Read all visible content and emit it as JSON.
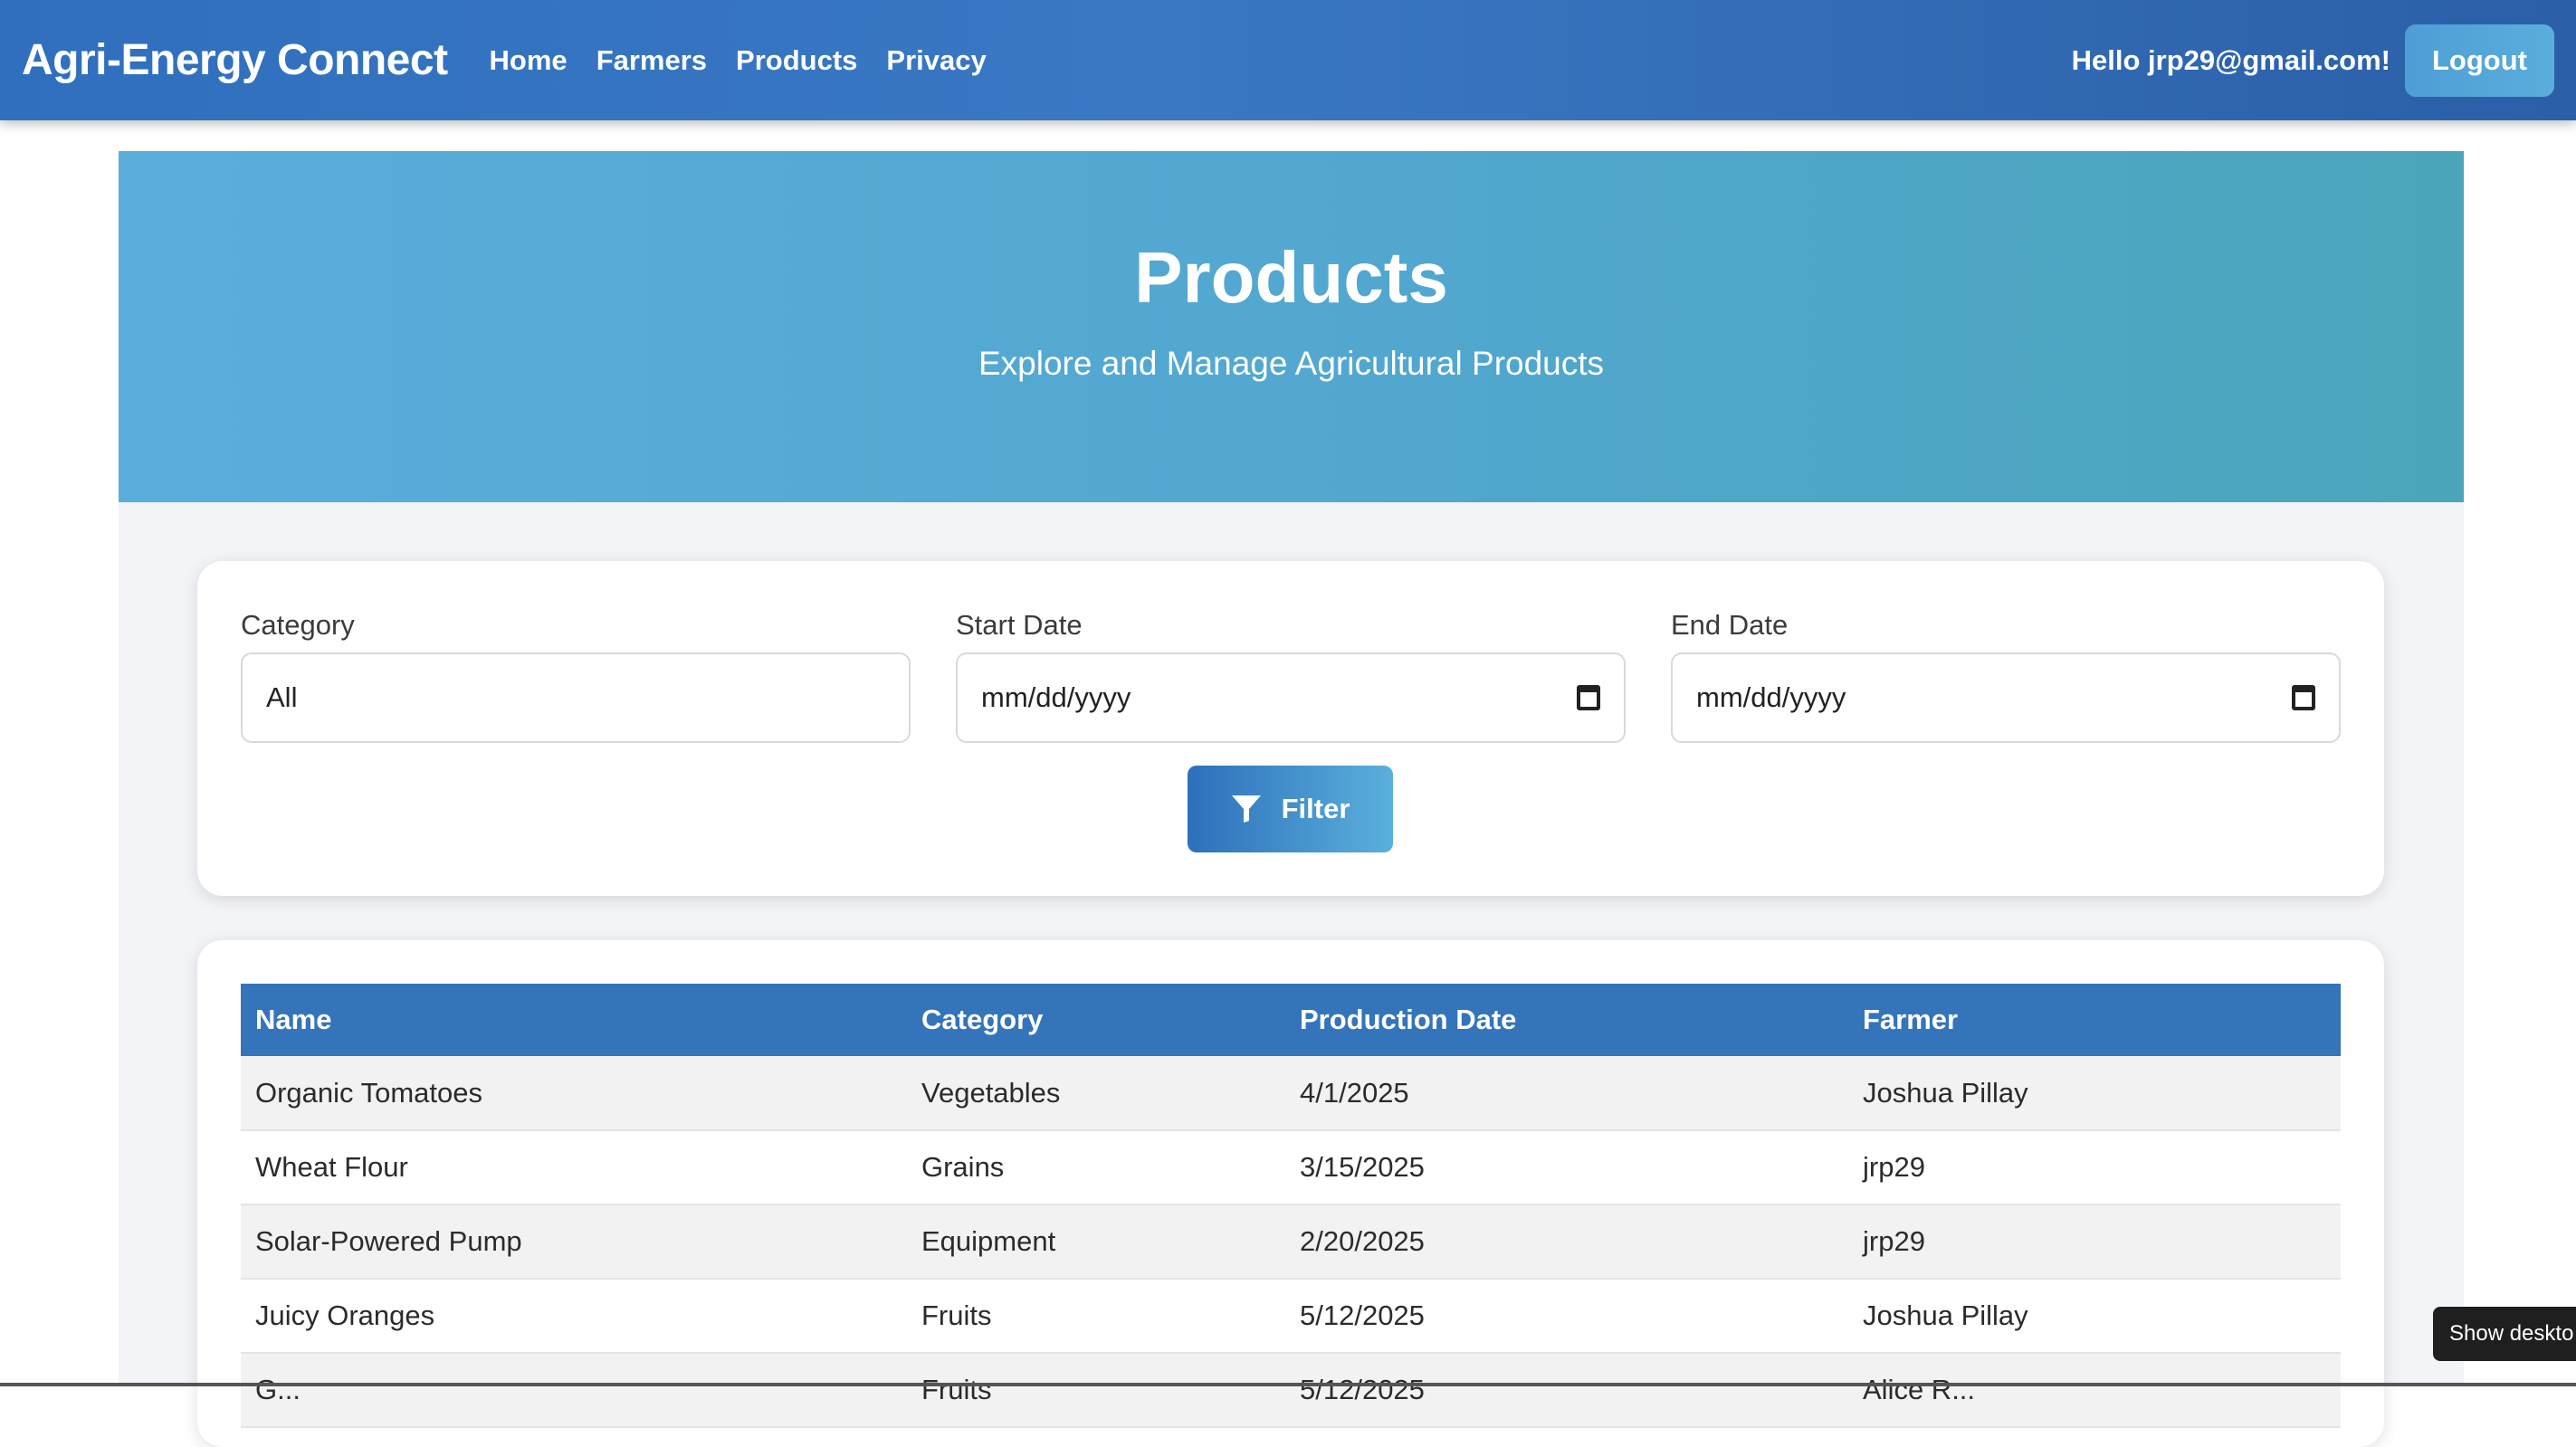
{
  "navbar": {
    "brand": "Agri-Energy Connect",
    "links": [
      "Home",
      "Farmers",
      "Products",
      "Privacy"
    ],
    "greeting": "Hello jrp29@gmail.com!",
    "logout_label": "Logout"
  },
  "hero": {
    "title": "Products",
    "subtitle": "Explore and Manage Agricultural Products"
  },
  "filters": {
    "category_label": "Category",
    "category_value": "All",
    "start_label": "Start Date",
    "start_placeholder": "mm/dd/yyyy",
    "end_label": "End Date",
    "end_placeholder": "mm/dd/yyyy",
    "filter_label": "Filter",
    "filter_icon": "filter-icon"
  },
  "table": {
    "headers": [
      "Name",
      "Category",
      "Production Date",
      "Farmer"
    ],
    "rows": [
      [
        "Organic Tomatoes",
        "Vegetables",
        "4/1/2025",
        "Joshua Pillay"
      ],
      [
        "Wheat Flour",
        "Grains",
        "3/15/2025",
        "jrp29"
      ],
      [
        "Solar-Powered Pump",
        "Equipment",
        "2/20/2025",
        "jrp29"
      ],
      [
        "Juicy Oranges",
        "Fruits",
        "5/12/2025",
        "Joshua Pillay"
      ],
      [
        "G...",
        "Fruits",
        "5/12/2025",
        "Alice R..."
      ]
    ]
  },
  "tooltip": {
    "text": "Show deskto"
  },
  "colors": {
    "navbar": "#2f6fbd",
    "hero": "#55abd5",
    "table_header": "#3474bb",
    "filter_button": "#2d6fbb"
  }
}
